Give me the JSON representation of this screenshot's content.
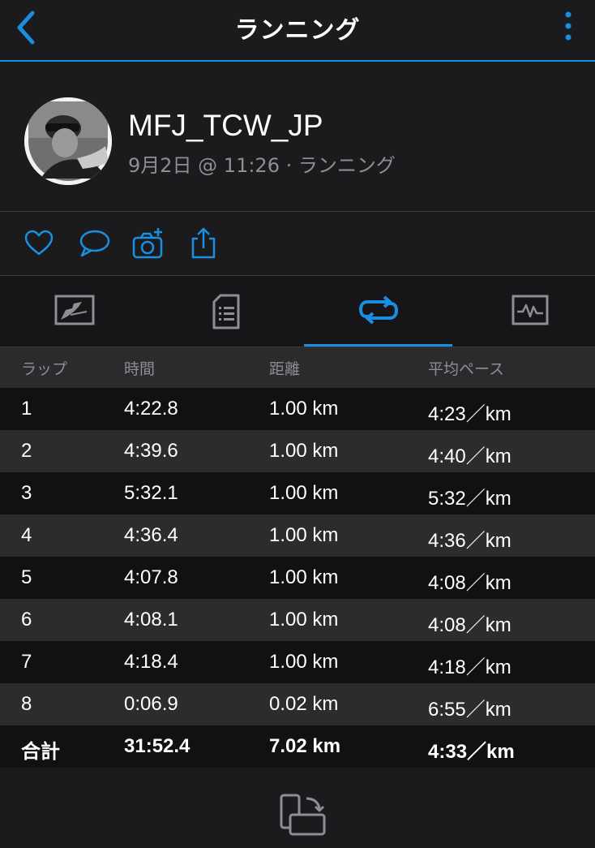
{
  "header": {
    "title": "ランニング",
    "back_icon": "chevron-left-icon",
    "menu_icon": "more-vertical-icon"
  },
  "profile": {
    "username": "MFJ_TCW_JP",
    "subline": "9月2日 @ 11:26 · ランニング"
  },
  "actions": [
    "heart-icon",
    "comment-icon",
    "add-photo-icon",
    "share-icon"
  ],
  "tabs": [
    {
      "name": "map-tab",
      "icon": "map-icon",
      "active": false
    },
    {
      "name": "details-tab",
      "icon": "document-icon",
      "active": false
    },
    {
      "name": "laps-tab",
      "icon": "laps-icon",
      "active": true
    },
    {
      "name": "graph-tab",
      "icon": "chart-icon",
      "active": false
    }
  ],
  "laps": {
    "headers": [
      "ラップ",
      "時間",
      "距離",
      "平均ペース"
    ],
    "rows": [
      {
        "lap": "1",
        "time": "4:22.8",
        "distance": "1.00 km",
        "pace": "4:23／km"
      },
      {
        "lap": "2",
        "time": "4:39.6",
        "distance": "1.00 km",
        "pace": "4:40／km"
      },
      {
        "lap": "3",
        "time": "5:32.1",
        "distance": "1.00 km",
        "pace": "5:32／km"
      },
      {
        "lap": "4",
        "time": "4:36.4",
        "distance": "1.00 km",
        "pace": "4:36／km"
      },
      {
        "lap": "5",
        "time": "4:07.8",
        "distance": "1.00 km",
        "pace": "4:08／km"
      },
      {
        "lap": "6",
        "time": "4:08.1",
        "distance": "1.00 km",
        "pace": "4:08／km"
      },
      {
        "lap": "7",
        "time": "4:18.4",
        "distance": "1.00 km",
        "pace": "4:18／km"
      },
      {
        "lap": "8",
        "time": "0:06.9",
        "distance": "0.02 km",
        "pace": "6:55／km"
      }
    ],
    "total": {
      "lap": "合計",
      "time": "31:52.4",
      "distance": "7.02 km",
      "pace": "4:33／km"
    }
  },
  "colors": {
    "accent": "#1a8ee1",
    "background": "#1b1b1d",
    "row_dark": "#111113",
    "row_light": "#2c2c2e",
    "muted_text": "#8e8e93"
  },
  "footer": {
    "rotate_icon": "rotate-screen-icon"
  }
}
